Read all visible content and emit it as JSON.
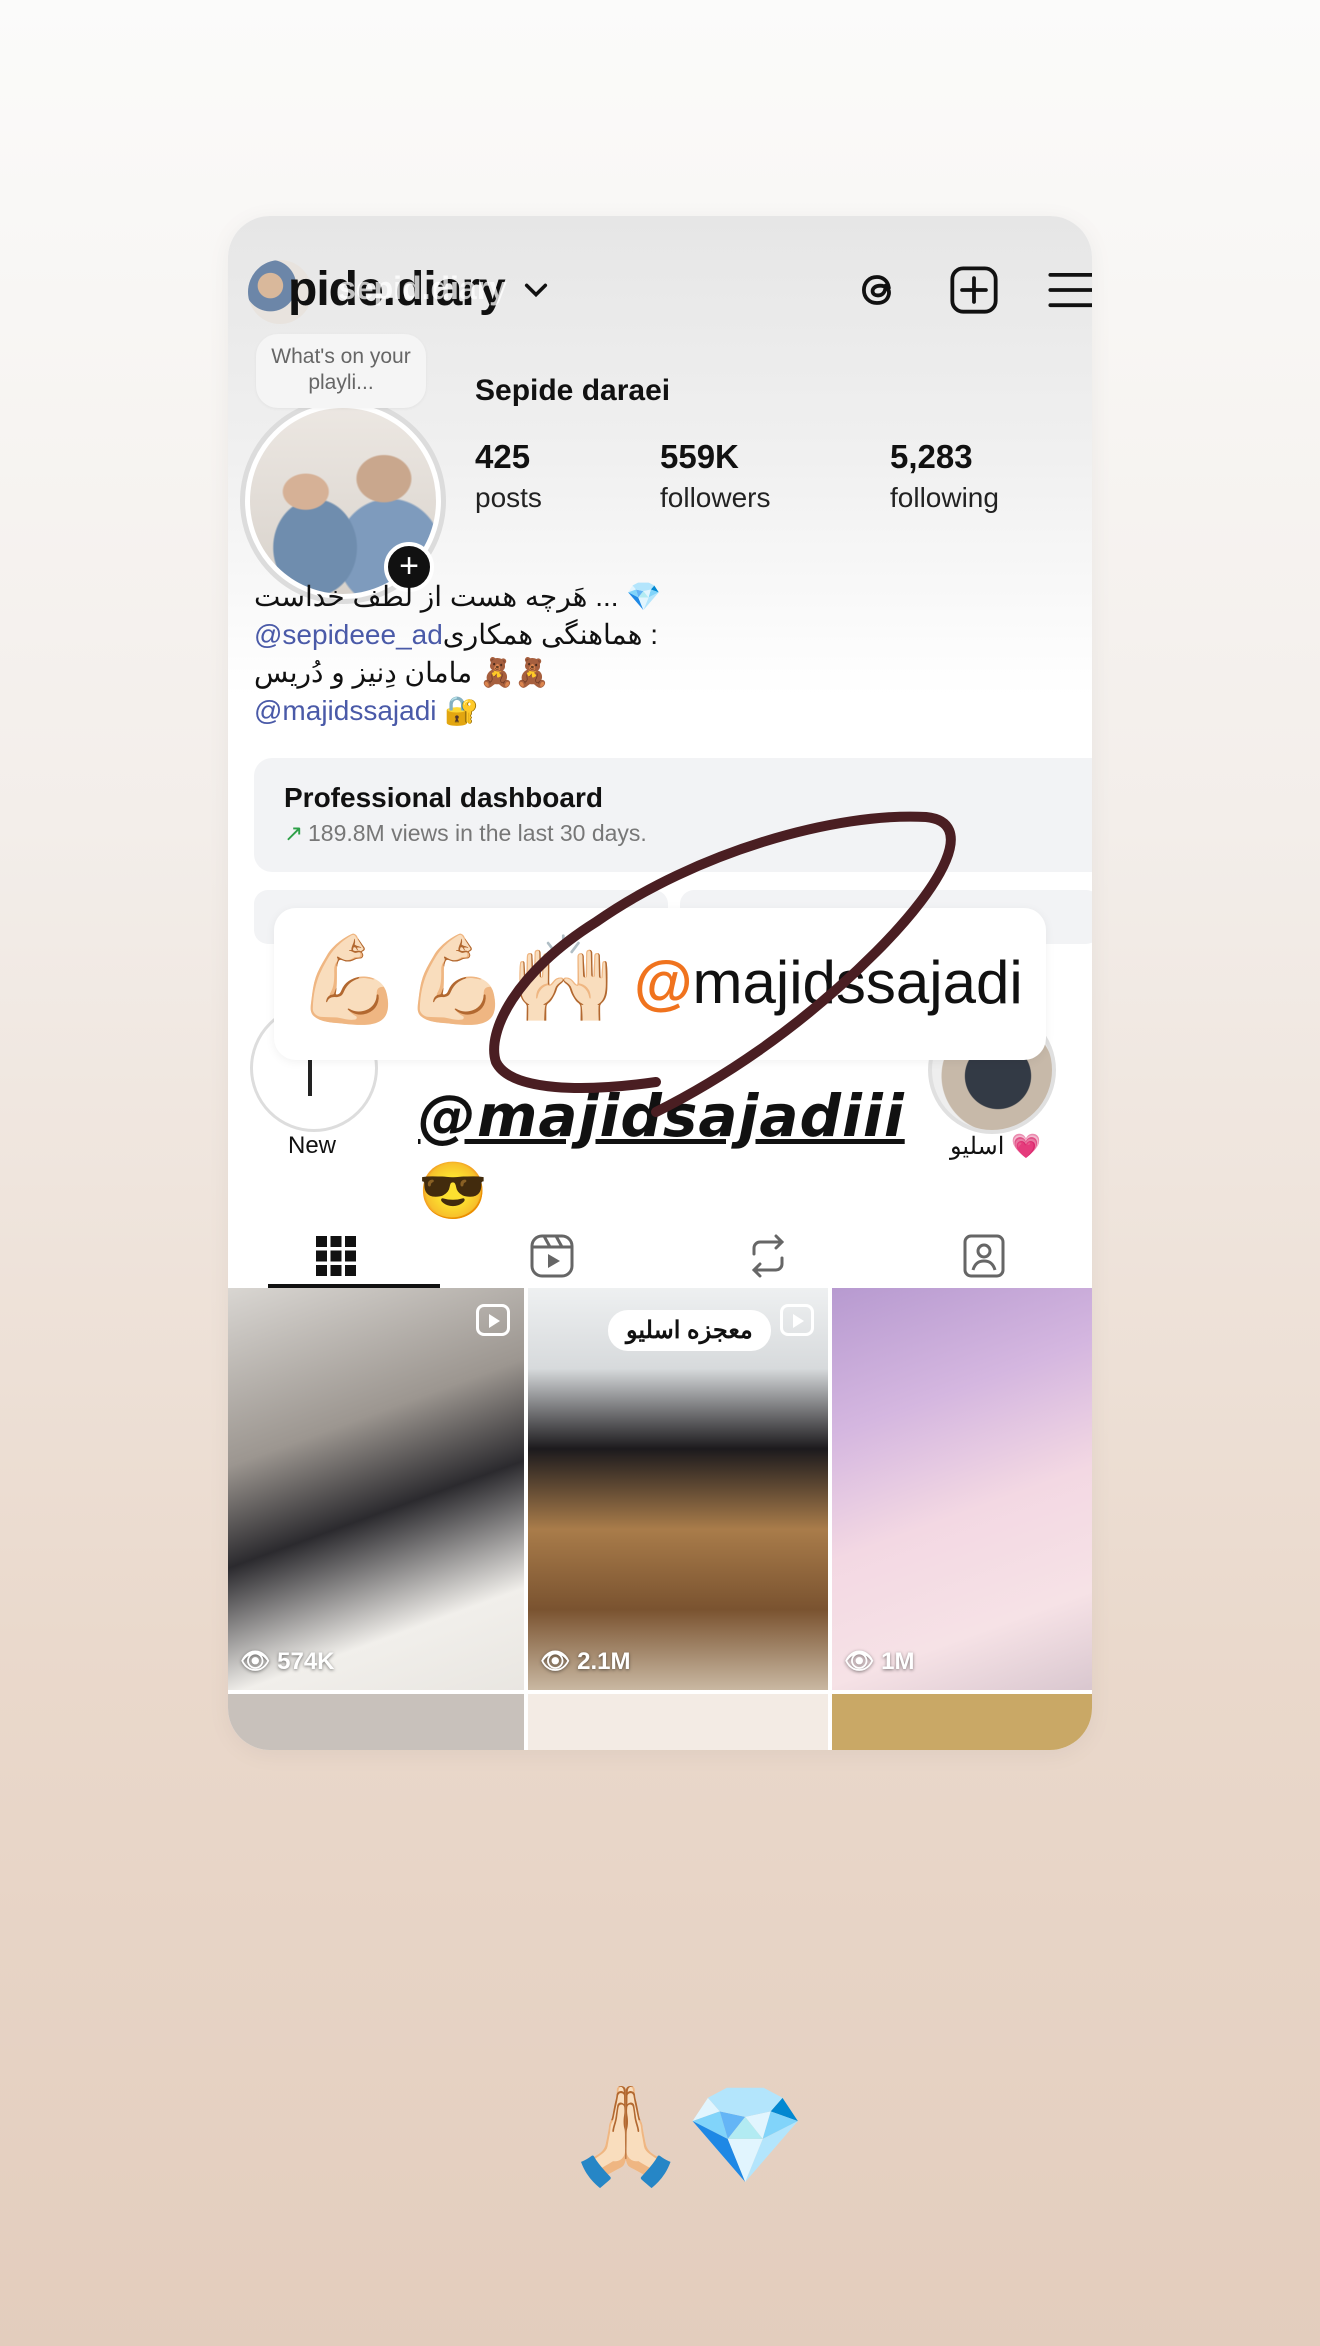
{
  "topbar": {
    "username": "pide.diary",
    "username_overlay": "sepid.diary",
    "chevron_icon": "chevron-down-icon",
    "threads_icon": "threads-icon",
    "add_icon": "plus-square-icon",
    "menu_icon": "hamburger-menu-icon"
  },
  "profile": {
    "note_bubble": "What's on your playli...",
    "full_name": "Sepide daraei",
    "stats": [
      {
        "num": "425",
        "label": "posts"
      },
      {
        "num": "559K",
        "label": "followers"
      },
      {
        "num": "5,283",
        "label": "following"
      }
    ]
  },
  "bio": {
    "line1": "هَرچه هست از لُطف خداست ... 💎",
    "line2_prefix": "هماهنگی همکاری : ",
    "line2_link": "@sepideee_ad",
    "line3": "مامان دِنیز و دُریس 🧸🧸",
    "line4_link": "@majidssajadi",
    "line4_emoji": "🔐"
  },
  "dashboard": {
    "title": "Professional dashboard",
    "subtitle": "189.8M views in the last 30 days."
  },
  "sticker": {
    "emojis": "💪🏻💪🏻🙌🏻",
    "handle": "majidssajadi"
  },
  "highlights": [
    {
      "label": "New"
    },
    {
      "label": "اسلیو 💗"
    }
  ],
  "overlay_text": {
    "handle": "@majidsajadiii",
    "emoji": "😎"
  },
  "tabs": [
    "grid",
    "reels",
    "reposts",
    "tagged"
  ],
  "grid": [
    {
      "views": "574K",
      "tag": ""
    },
    {
      "views": "2.1M",
      "tag": "معجزه اسلیو"
    },
    {
      "views": "1M",
      "tag": ""
    }
  ],
  "bottom_emoji": "🙏🏻💎",
  "colors": {
    "link": "#4a5aa8",
    "scribble": "#4a1e22",
    "growth": "#2ea048"
  }
}
